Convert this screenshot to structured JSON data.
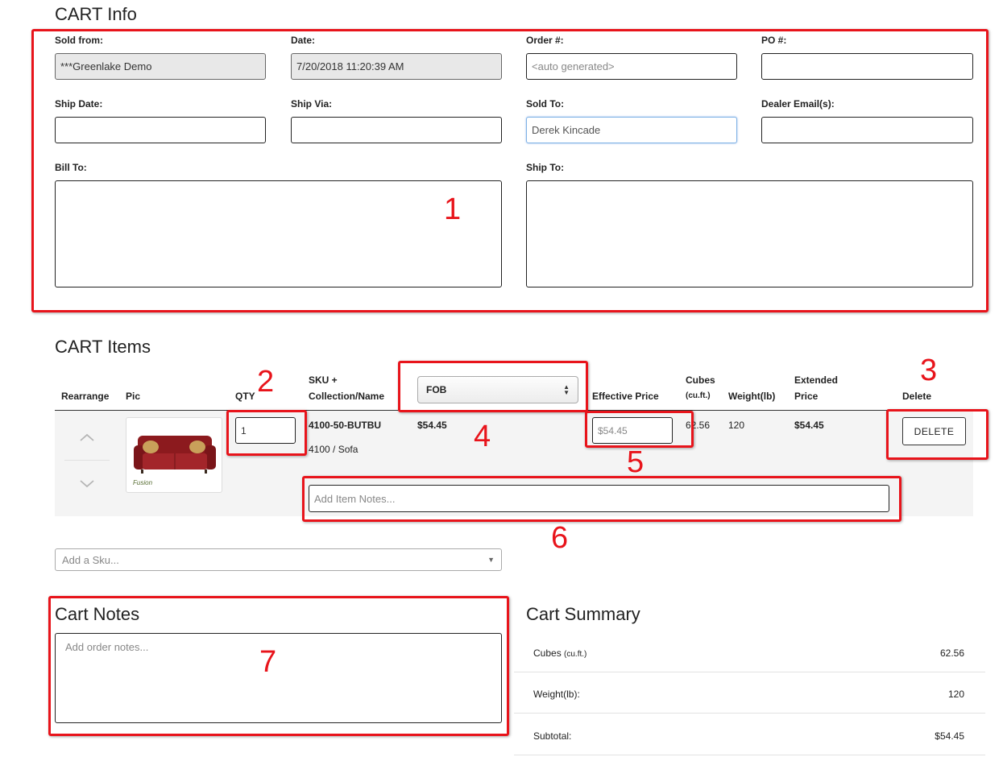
{
  "cart_info": {
    "title": "CART Info",
    "sold_from": {
      "label": "Sold from:",
      "value": "***Greenlake Demo"
    },
    "date": {
      "label": "Date:",
      "value": "7/20/2018 11:20:39 AM"
    },
    "order": {
      "label": "Order #:",
      "placeholder": "<auto generated>"
    },
    "po": {
      "label": "PO #:",
      "value": ""
    },
    "ship_date": {
      "label": "Ship Date:",
      "value": ""
    },
    "ship_via": {
      "label": "Ship Via:",
      "value": ""
    },
    "sold_to": {
      "label": "Sold To:",
      "value": "Derek Kincade"
    },
    "dealer_email": {
      "label": "Dealer Email(s):",
      "value": ""
    },
    "bill_to": {
      "label": "Bill To:",
      "value": ""
    },
    "ship_to": {
      "label": "Ship To:",
      "value": ""
    }
  },
  "cart_items": {
    "title": "CART Items",
    "headers": {
      "rearrange": "Rearrange",
      "pic": "Pic",
      "qty": "QTY",
      "sku_line1": "SKU +",
      "sku_line2": "Collection/Name",
      "price_select": "FOB",
      "effective_price": "Effective Price",
      "cubes": "Cubes",
      "cubes_unit": "(cu.ft.)",
      "weight": "Weight(lb)",
      "extended_line1": "Extended",
      "extended_line2": "Price",
      "delete": "Delete"
    },
    "rows": [
      {
        "qty": "1",
        "sku": "4100-50-BUTBU",
        "collection": "4100 / Sofa",
        "price": "$54.45",
        "effective_price_placeholder": "$54.45",
        "cubes": "62.56",
        "weight": "120",
        "extended": "$54.45",
        "delete_label": "DELETE",
        "notes_placeholder": "Add Item Notes...",
        "pic_brand": "Fusion"
      }
    ],
    "add_sku_placeholder": "Add a Sku..."
  },
  "cart_notes": {
    "title": "Cart Notes",
    "placeholder": "Add order notes..."
  },
  "cart_summary": {
    "title": "Cart Summary",
    "cubes_label": "Cubes",
    "cubes_unit": "(cu.ft.)",
    "cubes_value": "62.56",
    "weight_label": "Weight(lb):",
    "weight_value": "120",
    "subtotal_label": "Subtotal:",
    "subtotal_value": "$54.45"
  },
  "annotations": {
    "n1": "1",
    "n2": "2",
    "n3": "3",
    "n4": "4",
    "n5": "5",
    "n6": "6",
    "n7": "7",
    "color": "#e8141b"
  }
}
